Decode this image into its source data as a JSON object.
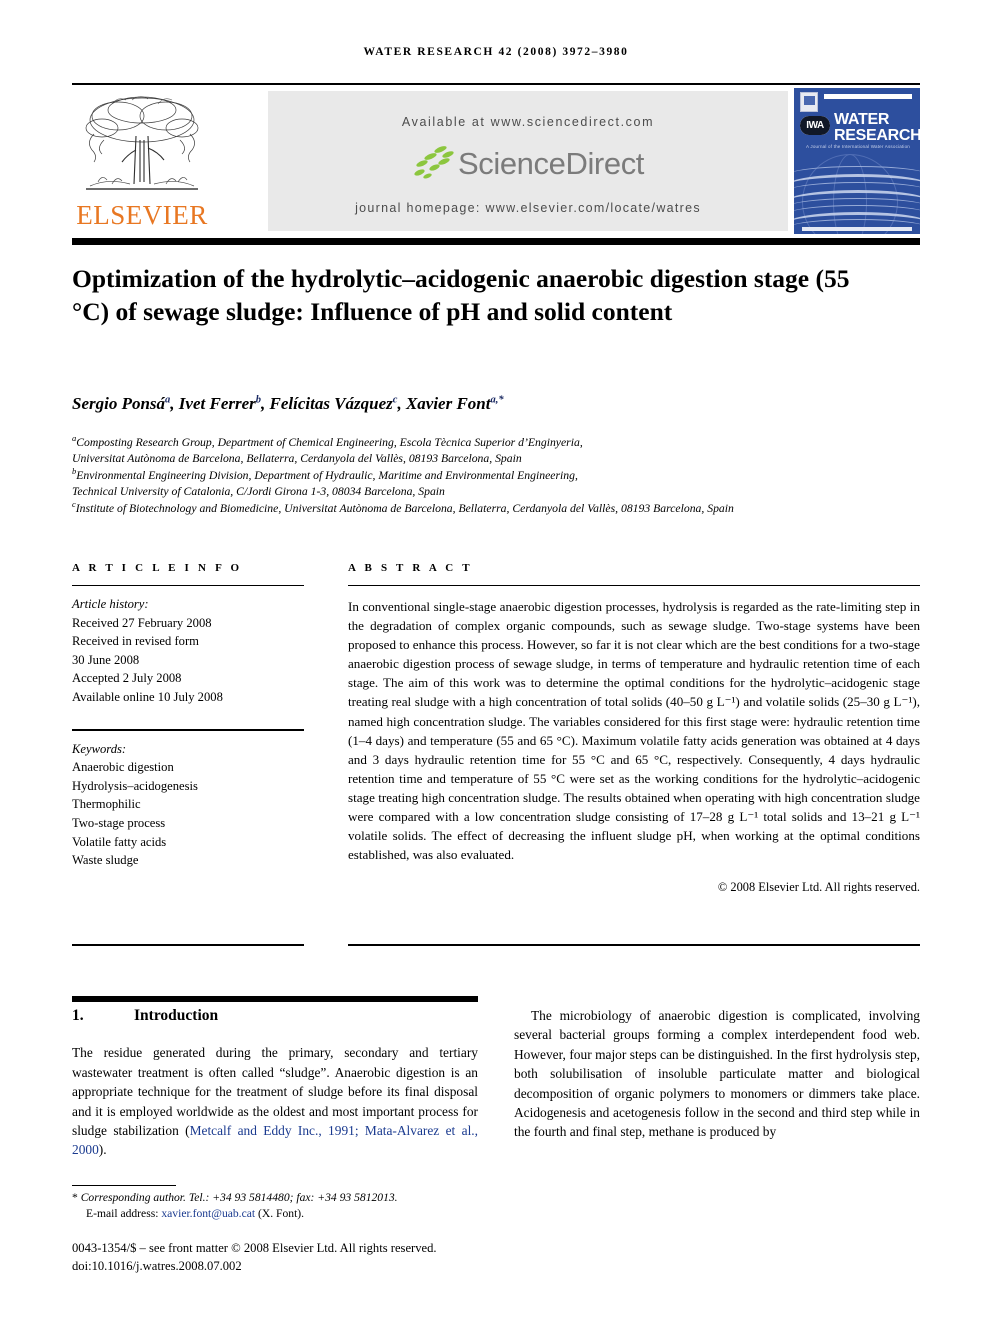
{
  "running_head": "WATER RESEARCH 42 (2008) 3972–3980",
  "banner": {
    "publisher": "ELSEVIER",
    "available_at": "Available at www.sciencedirect.com",
    "sciencedirect": "ScienceDirect",
    "journal_homepage": "journal homepage: www.elsevier.com/locate/watres",
    "cover": {
      "title_line1": "WATER",
      "title_line2": "RESEARCH",
      "imprint_logo": "IWA",
      "subtitle": "A Journal of the International Water Association"
    }
  },
  "article": {
    "title": "Optimization of the hydrolytic–acidogenic anaerobic digestion stage (55 °C) of sewage sludge: Influence of pH and solid content",
    "authors": [
      {
        "name": "Sergio Ponsá",
        "marks": "a"
      },
      {
        "name": "Ivet Ferrer",
        "marks": "b"
      },
      {
        "name": "Felícitas Vázquez",
        "marks": "c"
      },
      {
        "name": "Xavier Font",
        "marks": "a,*"
      }
    ],
    "affiliations": [
      {
        "mark": "a",
        "text": "Composting Research Group, Department of Chemical Engineering, Escola Tècnica Superior d’Enginyeria,"
      },
      {
        "mark": "",
        "text": "Universitat Autònoma de Barcelona, Bellaterra, Cerdanyola del Vallès, 08193 Barcelona, Spain"
      },
      {
        "mark": "b",
        "text": "Environmental Engineering Division, Department of Hydraulic, Maritime and Environmental Engineering,"
      },
      {
        "mark": "",
        "text": "Technical University of Catalonia, C/Jordi Girona 1-3, 08034 Barcelona, Spain"
      },
      {
        "mark": "c",
        "text": "Institute of Biotechnology and Biomedicine, Universitat Autònoma de Barcelona, Bellaterra, Cerdanyola del Vallès, 08193 Barcelona, Spain"
      }
    ]
  },
  "article_info": {
    "heading": "A R T I C L E   I N F O",
    "history_label": "Article history:",
    "history": [
      "Received 27 February 2008",
      "Received in revised form",
      "30 June 2008",
      "Accepted 2 July 2008",
      "Available online 10 July 2008"
    ],
    "keywords_label": "Keywords:",
    "keywords": [
      "Anaerobic digestion",
      "Hydrolysis–acidogenesis",
      "Thermophilic",
      "Two-stage process",
      "Volatile fatty acids",
      "Waste sludge"
    ]
  },
  "abstract": {
    "heading": "A B S T R A C T",
    "text": "In conventional single-stage anaerobic digestion processes, hydrolysis is regarded as the rate-limiting step in the degradation of complex organic compounds, such as sewage sludge. Two-stage systems have been proposed to enhance this process. However, so far it is not clear which are the best conditions for a two-stage anaerobic digestion process of sewage sludge, in terms of temperature and hydraulic retention time of each stage. The aim of this work was to determine the optimal conditions for the hydrolytic–acidogenic stage treating real sludge with a high concentration of total solids (40–50 g L⁻¹) and volatile solids (25–30 g L⁻¹), named high concentration sludge. The variables considered for this first stage were: hydraulic retention time (1–4 days) and temperature (55 and 65 °C). Maximum volatile fatty acids generation was obtained at 4 days and 3 days hydraulic retention time for 55 °C and 65 °C, respectively. Consequently, 4 days hydraulic retention time and temperature of 55 °C were set as the working conditions for the hydrolytic–acidogenic stage treating high concentration sludge. The results obtained when operating with high concentration sludge were compared with a low concentration sludge consisting of 17–28 g L⁻¹ total solids and 13–21 g L⁻¹ volatile solids. The effect of decreasing the influent sludge pH, when working at the optimal conditions established, was also evaluated.",
    "copyright": "© 2008 Elsevier Ltd. All rights reserved."
  },
  "introduction": {
    "number": "1.",
    "heading": "Introduction",
    "left_paragraph_part1": "The residue generated during the primary, secondary and tertiary wastewater treatment is often called “sludge”. Anaerobic digestion is an appropriate technique for the treatment of sludge before its final disposal and it is employed worldwide as the oldest and most important process for sludge stabilization (",
    "left_citation": "Metcalf and Eddy Inc., 1991; Mata-Alvarez et al., 2000",
    "left_paragraph_part2": ").",
    "right_paragraph": "The microbiology of anaerobic digestion is complicated, involving several bacterial groups forming a complex interdependent food web. However, four major steps can be distinguished. In the first hydrolysis step, both solubilisation of insoluble particulate matter and biological decomposition of organic polymers to monomers or dimmers take place. Acidogenesis and acetogenesis follow in the second and third step while in the fourth and final step, methane is produced by"
  },
  "footer": {
    "corresponding_marker": "*",
    "corresponding_text": "Corresponding author. Tel.: +34 93 5814480; fax: +34 93 5812013.",
    "email_label": "E-mail address:",
    "email": "xavier.font@uab.cat",
    "email_suffix": "(X. Font).",
    "front_matter": "0043-1354/$ – see front matter © 2008 Elsevier Ltd. All rights reserved.",
    "doi": "doi:10.1016/j.watres.2008.07.002"
  }
}
